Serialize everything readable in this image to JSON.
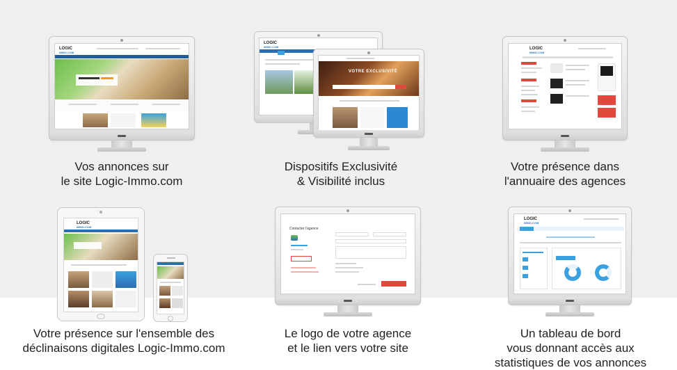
{
  "cards": [
    {
      "caption_lines": [
        "Vos annonces sur",
        "le site Logic-Immo.com"
      ]
    },
    {
      "caption_lines": [
        "Dispositifs Exclusivité",
        "& Visibilité inclus"
      ]
    },
    {
      "caption_lines": [
        "Votre présence dans",
        "l'annuaire des agences"
      ]
    },
    {
      "caption_lines": [
        "Votre présence sur l'ensemble des",
        "déclinaisons digitales Logic-Immo.com"
      ]
    },
    {
      "caption_lines": [
        "Le logo de votre agence",
        "et le lien vers votre site"
      ]
    },
    {
      "caption_lines": [
        "Un tableau de bord",
        "vous donnant accès aux",
        "statistiques de vos annonces"
      ]
    }
  ],
  "screens": {
    "logo_main": "LOGIC",
    "logo_sub": "IMMO.COM",
    "hero_exclusive": "VOTRE EXCLUSIVITÉ",
    "contact_title": "Contacter l'agence"
  },
  "colors": {
    "blue": "#2b6fb0",
    "light_blue": "#3aa0e0",
    "red": "#e0483b",
    "background": "#efefef"
  }
}
